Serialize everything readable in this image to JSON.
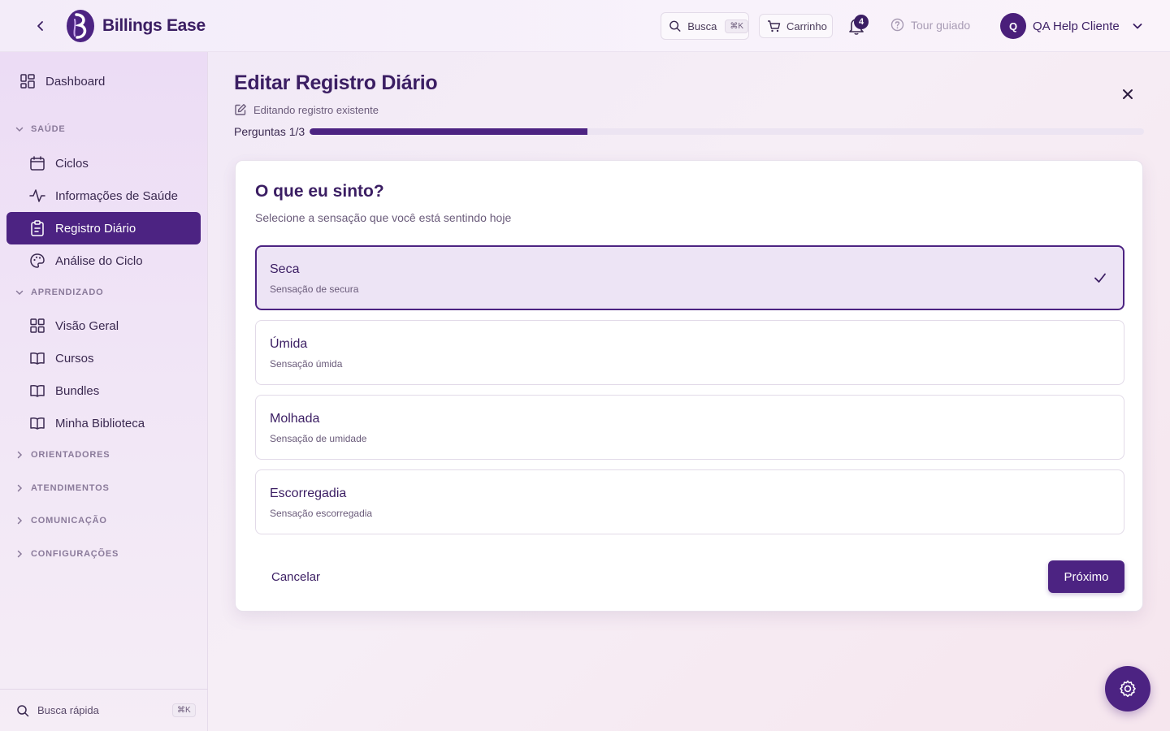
{
  "header": {
    "brand": "Billings Ease",
    "search_label": "Busca",
    "search_shortcut": "⌘K",
    "cart_label": "Carrinho",
    "notification_count": "4",
    "tour_label": "Tour guiado",
    "user_initial": "Q",
    "user_name": "QA Help Cliente"
  },
  "sidebar": {
    "dashboard": "Dashboard",
    "sections": {
      "saude": "SAÚDE",
      "aprendizado": "APRENDIZADO",
      "orientadores": "ORIENTADORES",
      "atendimentos": "ATENDIMENTOS",
      "comunicacao": "COMUNICAÇÃO",
      "configuracoes": "CONFIGURAÇÕES"
    },
    "items": {
      "ciclos": "Ciclos",
      "informacoes": "Informações de Saúde",
      "registro": "Registro Diário",
      "analise": "Análise do Ciclo",
      "visao": "Visão Geral",
      "cursos": "Cursos",
      "bundles": "Bundles",
      "biblioteca": "Minha Biblioteca"
    },
    "quick_search": "Busca rápida",
    "quick_search_shortcut": "⌘K"
  },
  "page": {
    "title": "Editar Registro Diário",
    "subtitle": "Editando registro existente",
    "progress_label": "Perguntas 1/3",
    "progress_fraction": 0.333
  },
  "question": {
    "title": "O que eu sinto?",
    "subtitle": "Selecione a sensação que você está sentindo hoje",
    "options": [
      {
        "label": "Seca",
        "desc": "Sensação de secura",
        "selected": true
      },
      {
        "label": "Úmida",
        "desc": "Sensação úmida",
        "selected": false
      },
      {
        "label": "Molhada",
        "desc": "Sensação de umidade",
        "selected": false
      },
      {
        "label": "Escorregadia",
        "desc": "Sensação escorregadia",
        "selected": false
      }
    ]
  },
  "actions": {
    "cancel": "Cancelar",
    "next": "Próximo"
  },
  "colors": {
    "accent": "#4c2382",
    "selected_bg": "#ede4f5"
  }
}
